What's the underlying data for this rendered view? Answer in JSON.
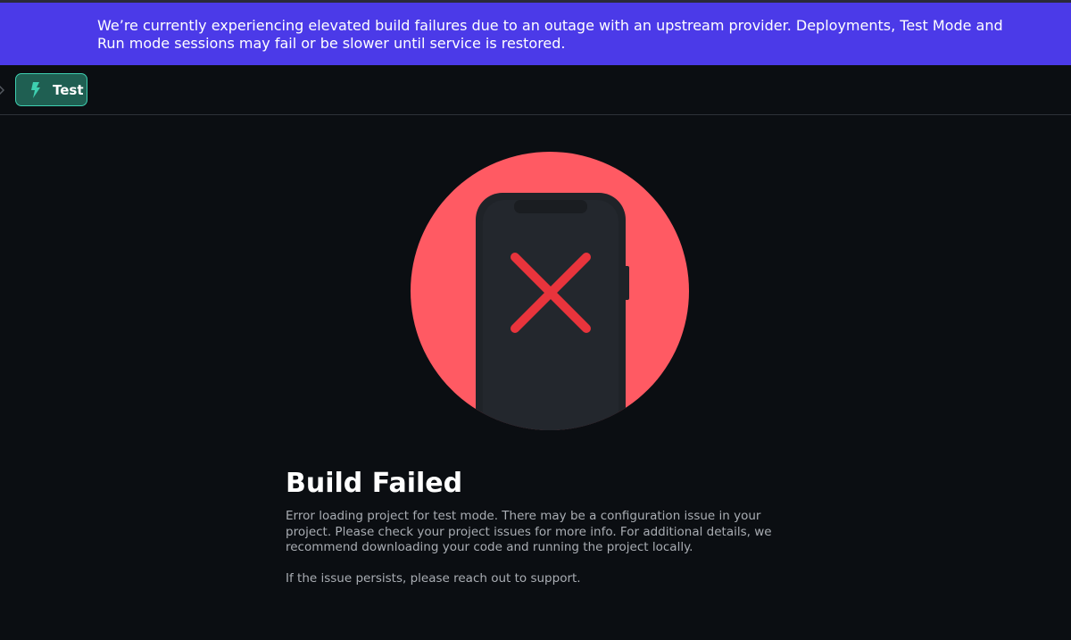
{
  "banner": {
    "message": "We’re currently experiencing elevated build failures due to an outage with an upstream provider. Deployments, Test Mode and Run mode sessions may fail or be slower until service is restored."
  },
  "toolbar": {
    "chevron_icon": "chevron-right-icon",
    "test_button": {
      "label": "Test",
      "icon": "lightning-bolt-icon"
    }
  },
  "illustration": {
    "icon": "phone-error-icon",
    "circle_color": "#ff5a63",
    "phone_color": "#1f2328",
    "x_color": "#e8343c"
  },
  "error": {
    "title": "Build Failed",
    "message": "Error loading project for test mode. There may be a configuration issue in your project. Please check your project issues for more info. For additional details, we recommend downloading your code and running the project locally.",
    "followup": "If the issue persists, please reach out to support."
  },
  "colors": {
    "banner_bg": "#4b3ae8",
    "page_bg": "#0b0e12",
    "accent": "#3ecfb0"
  }
}
